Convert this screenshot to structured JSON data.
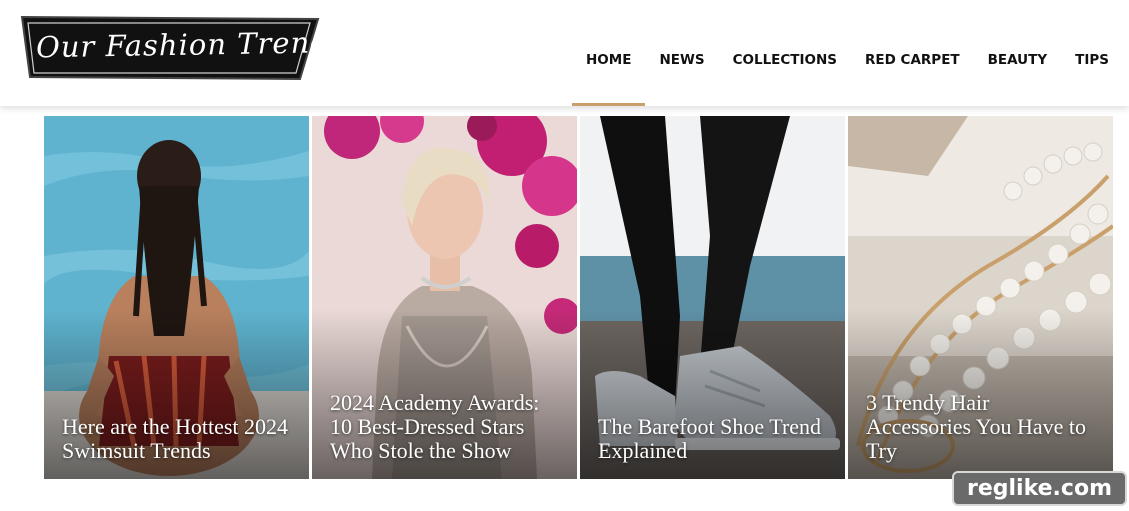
{
  "site": {
    "logo_text": "Our Fashion Trends"
  },
  "nav": {
    "items": [
      {
        "label": "HOME",
        "active": true
      },
      {
        "label": "NEWS"
      },
      {
        "label": "COLLECTIONS"
      },
      {
        "label": "RED CARPET"
      },
      {
        "label": "BEAUTY"
      },
      {
        "label": "TIPS"
      }
    ]
  },
  "articles": [
    {
      "title": "Here are the Hottest 2024 Swimsuit Trends",
      "image": "swimsuit-photo"
    },
    {
      "title": "2024 Academy Awards: 10 Best-Dressed Stars Who Stole the Show",
      "image": "red-carpet-photo"
    },
    {
      "title": "The Barefoot Shoe Trend Explained",
      "image": "sneaker-photo"
    },
    {
      "title": "3 Trendy Hair Accessories You Have to Try",
      "image": "pearl-hair-clip-photo"
    }
  ],
  "watermark": "reglike.com",
  "colors": {
    "accent": "#c9a06b",
    "nav_text": "#111111",
    "logo_bg": "#111111"
  }
}
